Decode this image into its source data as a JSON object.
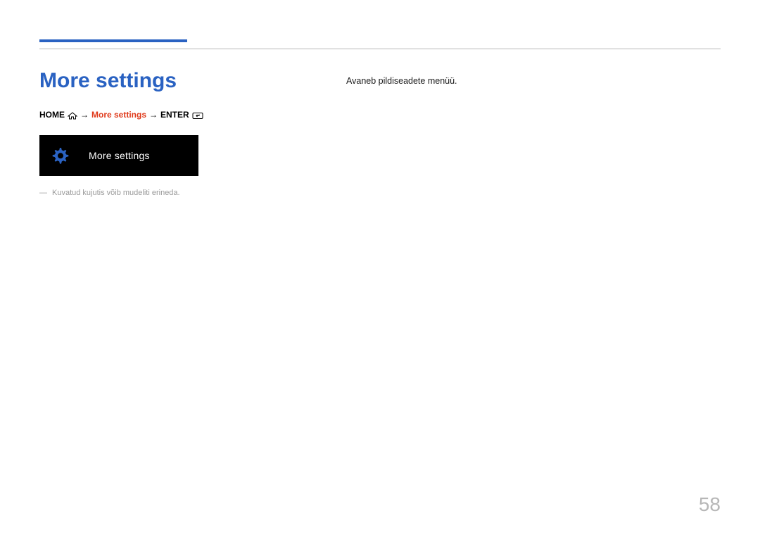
{
  "heading": "More settings",
  "breadcrumb": {
    "home": "HOME",
    "arrow1": "→",
    "current": "More settings",
    "arrow2": "→",
    "enter": "ENTER"
  },
  "tile": {
    "label": "More settings"
  },
  "footnote": {
    "dash": "―",
    "text": "Kuvatud kujutis võib mudeliti erineda."
  },
  "description": "Avaneb pildiseadete menüü.",
  "pageNumber": "58",
  "colors": {
    "accent": "#2a62c2",
    "highlight": "#e03a1b",
    "muted": "#b7b7b7"
  }
}
